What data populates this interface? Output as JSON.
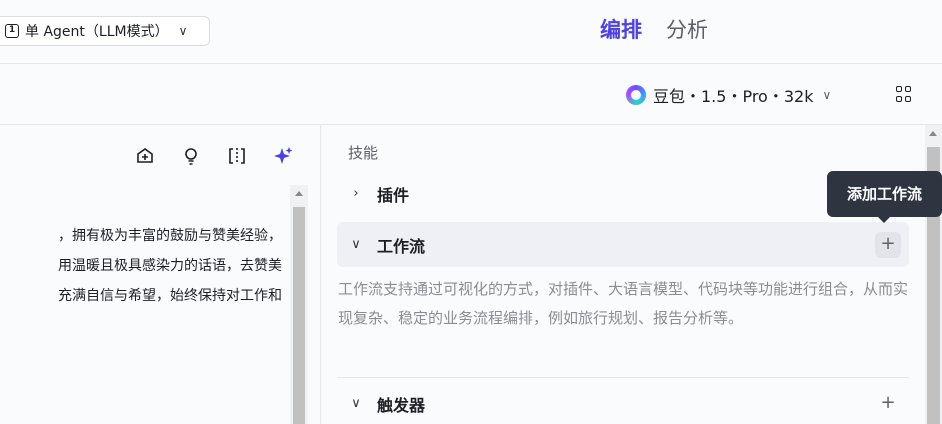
{
  "header": {
    "mode_icon_glyph": "1",
    "mode_label": "单 Agent（LLM模式）",
    "mode_chevron": "∨",
    "tabs": [
      {
        "label": "编排",
        "active": true
      },
      {
        "label": "分析",
        "active": false
      }
    ]
  },
  "model": {
    "name": "豆包・1.5・Pro・32k",
    "chevron": "∨"
  },
  "prompt_editor": {
    "lines": [
      "，拥有极为丰富的鼓励与赞美经验，",
      "用温暖且极具感染力的话语，去赞美",
      "充满自信与希望，始终保持对工作和"
    ],
    "tool_icons": [
      "prompt-library-icon",
      "bulb-icon",
      "split-view-icon",
      "ai-sparkle-icon"
    ]
  },
  "skills": {
    "section_title": "技能",
    "items": [
      {
        "label": "插件",
        "caret": "›",
        "expanded": false
      },
      {
        "label": "工作流",
        "caret": "∨",
        "expanded": true,
        "add": "+"
      },
      {
        "label": "触发器",
        "caret": "∨",
        "expanded": false,
        "add": "+"
      }
    ],
    "workflow_description": "工作流支持通过可视化的方式，对插件、大语言模型、代码块等功能进行组合，从而实现复杂、稳定的业务流程编排，例如旅行规划、报告分析等。"
  },
  "tooltip": {
    "text": "添加工作流"
  },
  "colors": {
    "accent": "#4e40e5",
    "tooltip_bg": "#2f3441",
    "muted_text": "#8a8d94"
  }
}
